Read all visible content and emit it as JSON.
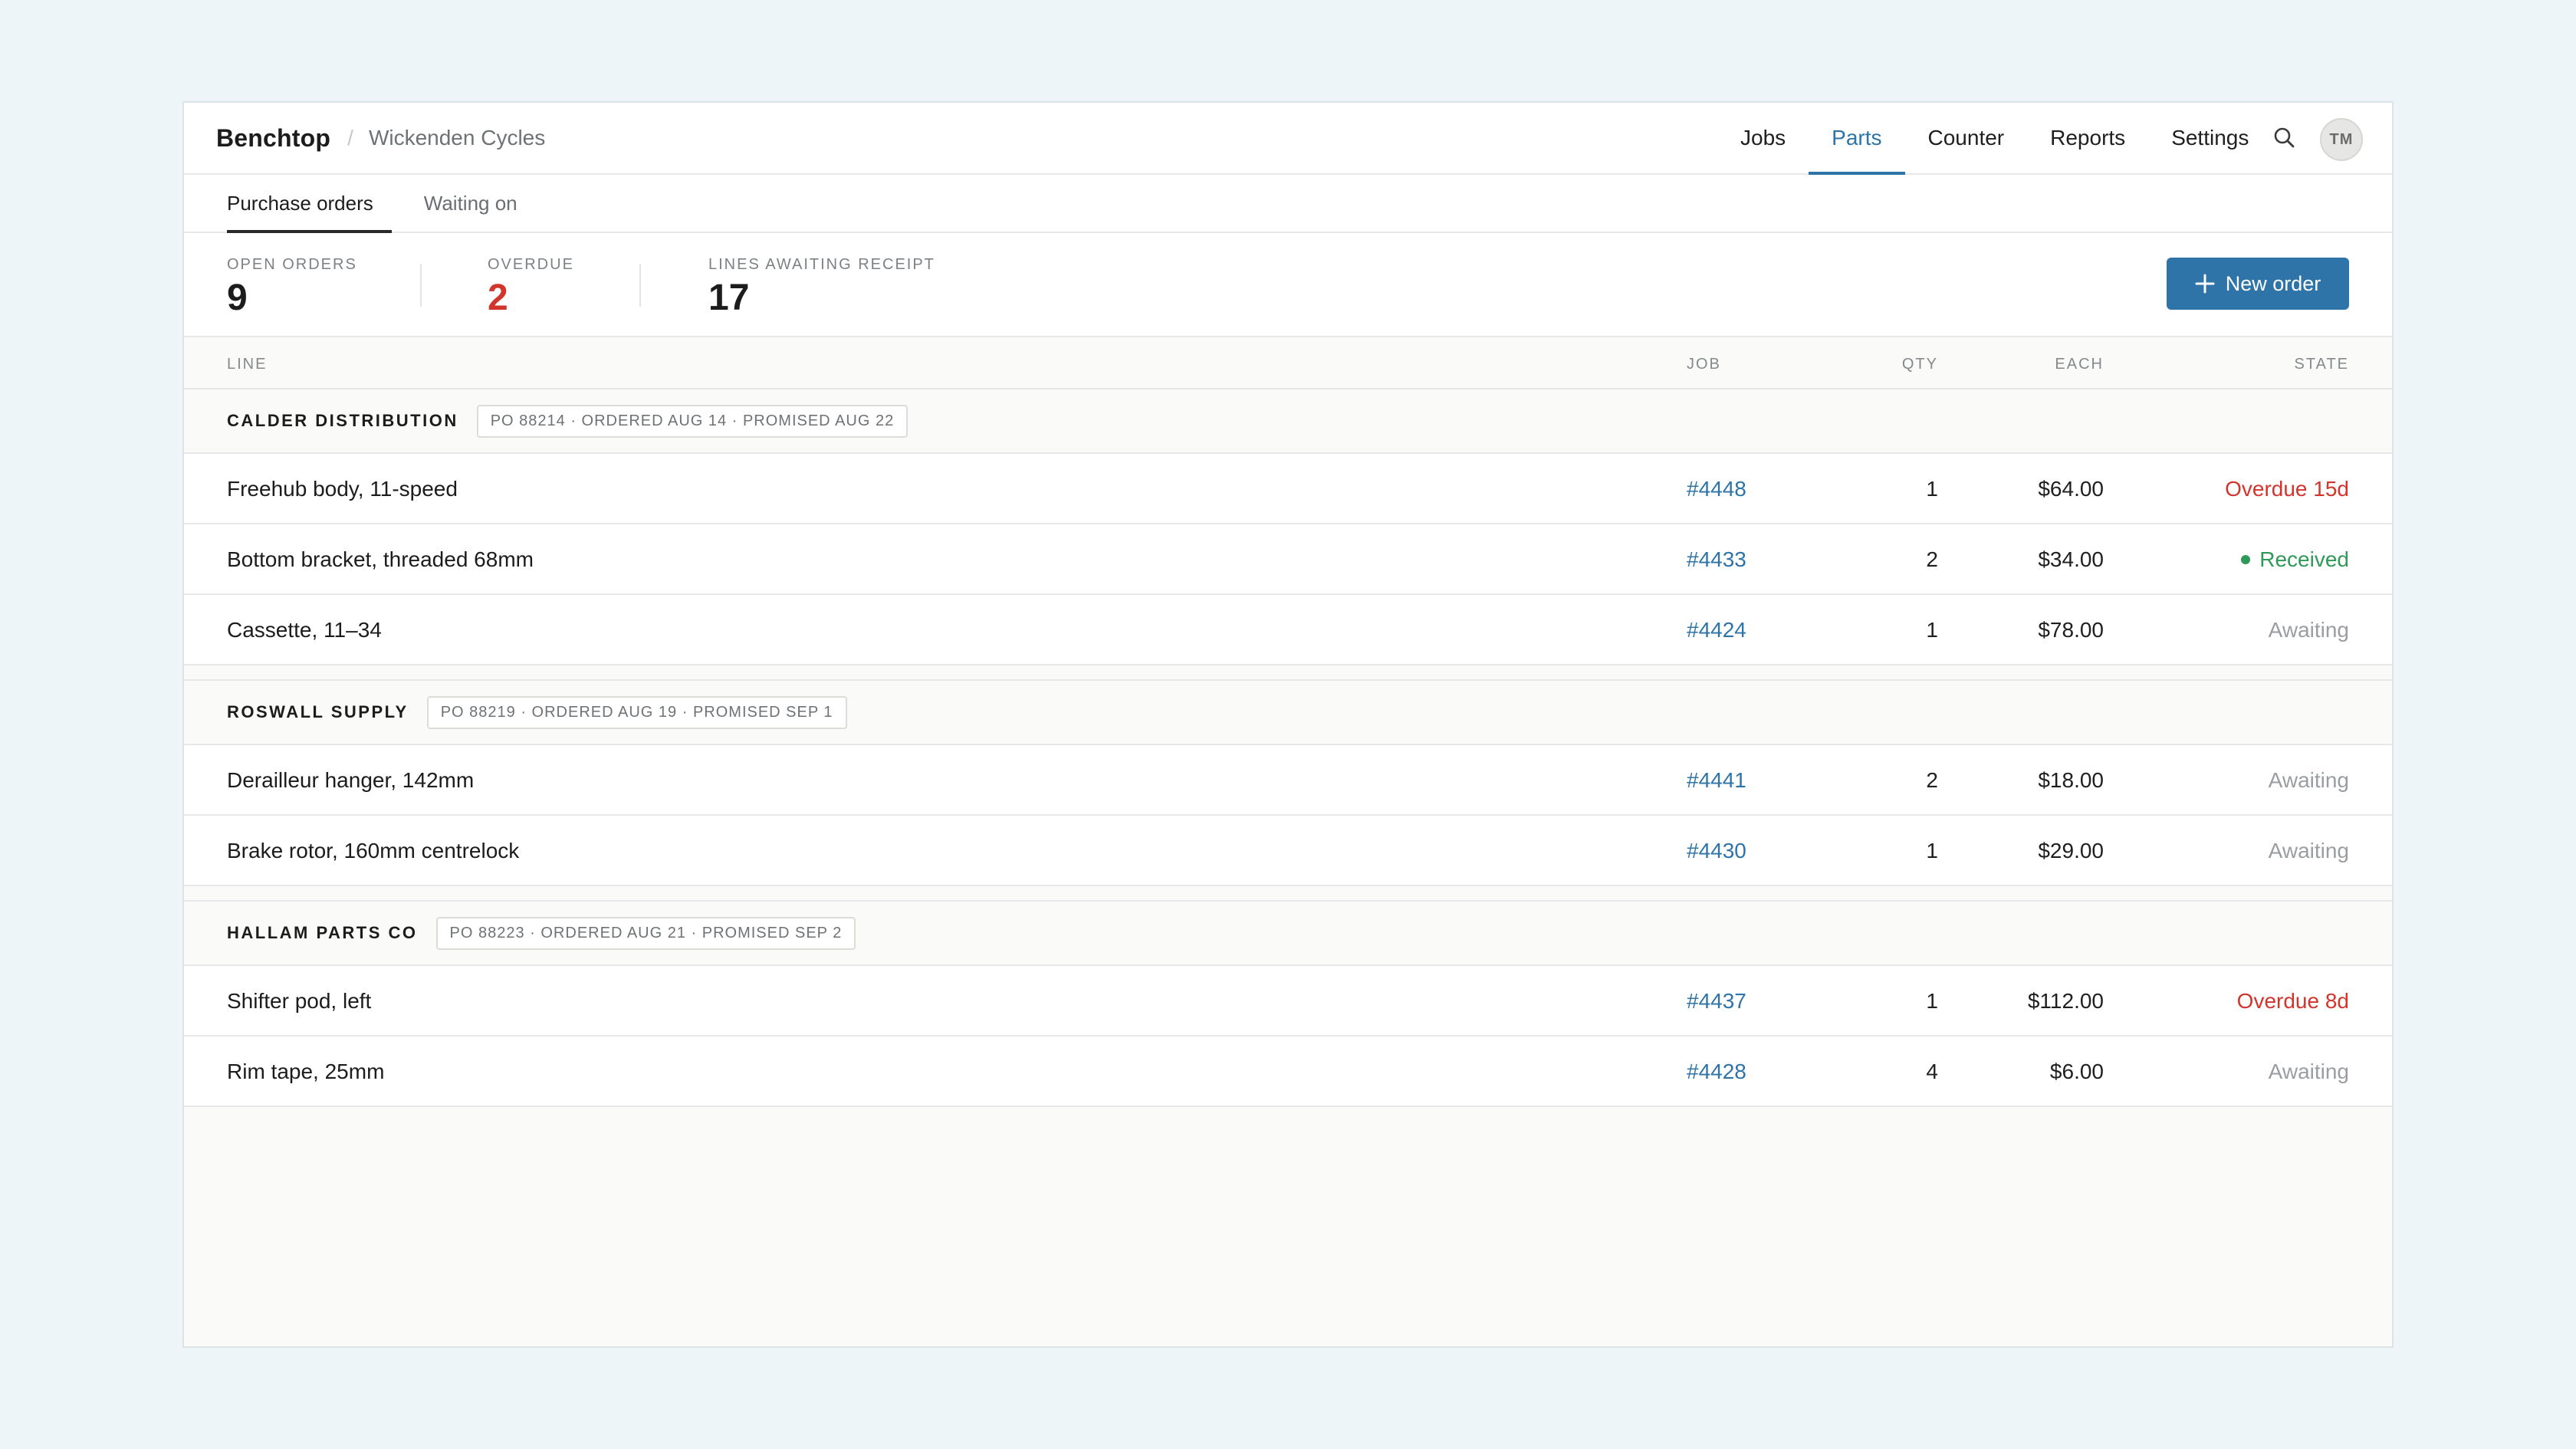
{
  "app": {
    "brand": "Benchtop",
    "shop": "Wickenden Cycles",
    "separator": "/",
    "accent": "#2e74a8"
  },
  "nav": {
    "items": [
      {
        "label": "Jobs",
        "active": false
      },
      {
        "label": "Parts",
        "active": true
      },
      {
        "label": "Counter",
        "active": false
      },
      {
        "label": "Reports",
        "active": false
      },
      {
        "label": "Settings",
        "active": false
      }
    ],
    "search_icon": "search-icon",
    "avatar": "TM"
  },
  "subtabs": [
    {
      "label": "Purchase orders",
      "active": true
    },
    {
      "label": "Waiting on",
      "active": false
    }
  ],
  "stats": {
    "open_orders": {
      "label": "OPEN ORDERS",
      "value": "9"
    },
    "overdue": {
      "label": "OVERDUE",
      "value": "2"
    },
    "lines_awaiting": {
      "label": "LINES AWAITING RECEIPT",
      "value": "17"
    }
  },
  "new_order": {
    "label": "New order",
    "icon": "plus-icon"
  },
  "table": {
    "headers": {
      "line": "LINE",
      "job": "JOB",
      "qty": "QTY",
      "each": "EACH",
      "state": "STATE"
    },
    "groups": [
      {
        "vendor": "CALDER DISTRIBUTION",
        "po": "PO 88214 · ORDERED AUG 14 · PROMISED AUG 22",
        "rows": [
          {
            "line": "Freehub body, 11-speed",
            "job": "#4448",
            "qty": "1",
            "each": "$64.00",
            "state": "Overdue 15d",
            "status": "overdue"
          },
          {
            "line": "Bottom bracket, threaded 68mm",
            "job": "#4433",
            "qty": "2",
            "each": "$34.00",
            "state": "Received",
            "status": "received"
          },
          {
            "line": "Cassette, 11–34",
            "job": "#4424",
            "qty": "1",
            "each": "$78.00",
            "state": "Awaiting",
            "status": "awaiting"
          }
        ]
      },
      {
        "vendor": "ROSWALL SUPPLY",
        "po": "PO 88219 · ORDERED AUG 19 · PROMISED SEP 1",
        "rows": [
          {
            "line": "Derailleur hanger, 142mm",
            "job": "#4441",
            "qty": "2",
            "each": "$18.00",
            "state": "Awaiting",
            "status": "awaiting"
          },
          {
            "line": "Brake rotor, 160mm centrelock",
            "job": "#4430",
            "qty": "1",
            "each": "$29.00",
            "state": "Awaiting",
            "status": "awaiting"
          }
        ]
      },
      {
        "vendor": "HALLAM PARTS CO",
        "po": "PO 88223 · ORDERED AUG 21 · PROMISED SEP 2",
        "rows": [
          {
            "line": "Shifter pod, left",
            "job": "#4437",
            "qty": "1",
            "each": "$112.00",
            "state": "Overdue 8d",
            "status": "overdue"
          },
          {
            "line": "Rim tape, 25mm",
            "job": "#4428",
            "qty": "4",
            "each": "$6.00",
            "state": "Awaiting",
            "status": "awaiting"
          }
        ]
      }
    ]
  },
  "colors": {
    "overdue": "#d2352c",
    "received": "#2f9a58",
    "awaiting": "#9a9ea2"
  }
}
